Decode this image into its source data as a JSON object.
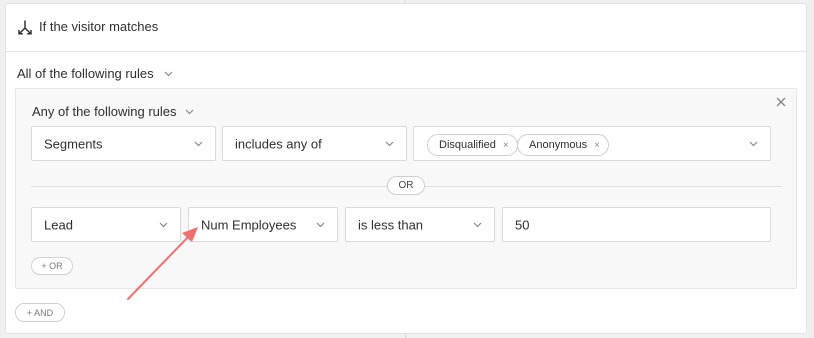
{
  "header": {
    "title": "If the visitor matches"
  },
  "outer_group": {
    "mode": "All of the following rules",
    "add_label": "+ AND"
  },
  "inner_group": {
    "mode": "Any of the following rules",
    "or_separator": "OR",
    "add_label": "+ OR",
    "rules": [
      {
        "source": "Segments",
        "operator": "includes any of",
        "tags": [
          "Disqualified",
          "Anonymous"
        ]
      },
      {
        "source": "Lead",
        "attribute": "Num Employees",
        "operator": "is less than",
        "value": "50"
      }
    ]
  },
  "annotation": {
    "arrow_color": "#f07070"
  },
  "colors": {
    "border": "#d9d9d9",
    "panel_bg": "#f8f8f8"
  }
}
